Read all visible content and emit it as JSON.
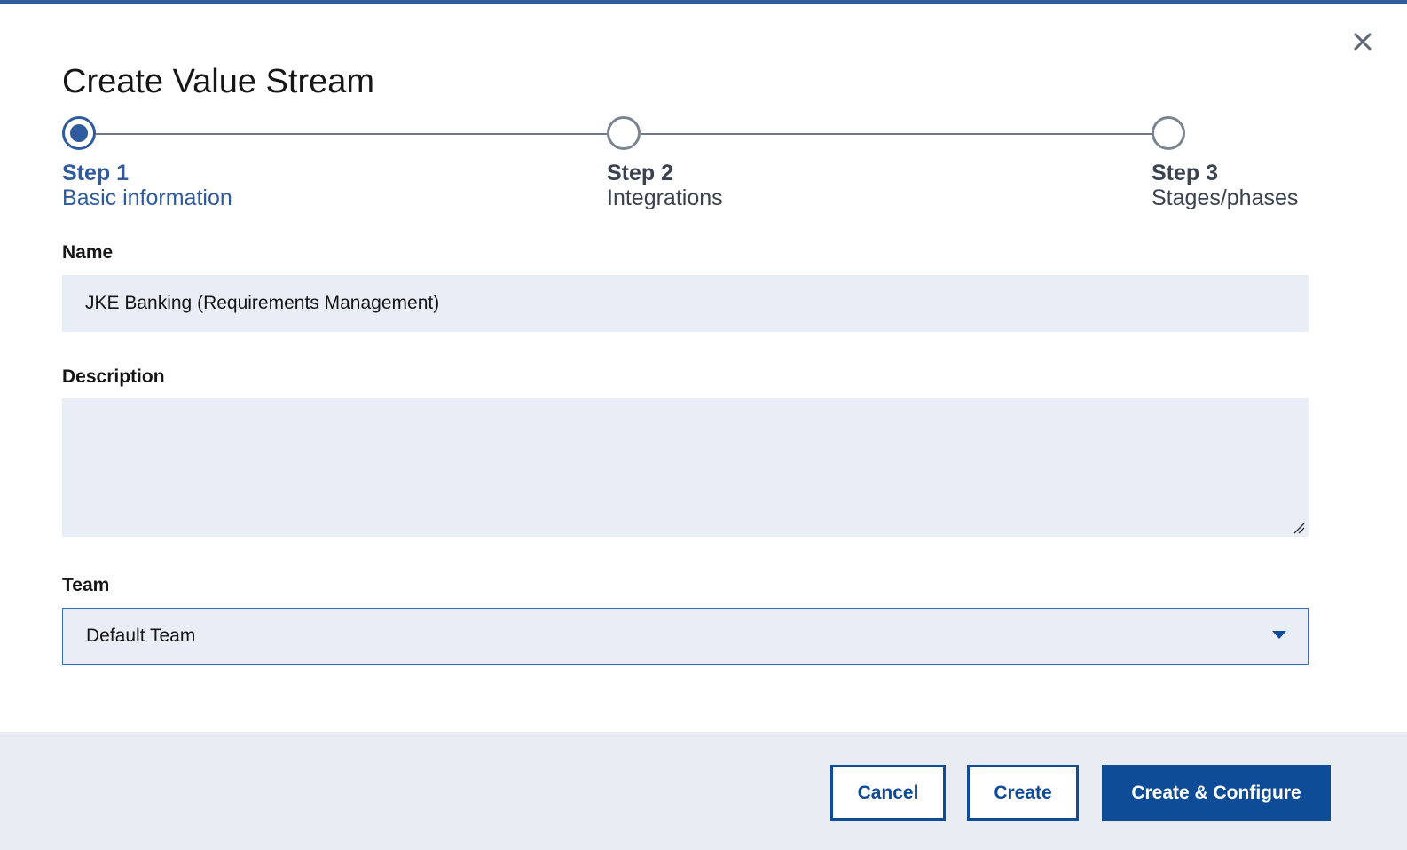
{
  "dialog": {
    "title": "Create Value Stream",
    "close_icon": "close-icon"
  },
  "stepper": {
    "steps": [
      {
        "number": "Step 1",
        "label": "Basic information",
        "state": "active"
      },
      {
        "number": "Step 2",
        "label": "Integrations",
        "state": "inactive"
      },
      {
        "number": "Step 3",
        "label": "Stages/phases",
        "state": "inactive"
      }
    ]
  },
  "form": {
    "name": {
      "label": "Name",
      "value": "JKE Banking (Requirements Management)"
    },
    "description": {
      "label": "Description",
      "value": ""
    },
    "team": {
      "label": "Team",
      "selected": "Default Team",
      "icon": "chevron-down-icon"
    }
  },
  "footer": {
    "cancel_label": "Cancel",
    "create_label": "Create",
    "create_configure_label": "Create & Configure"
  },
  "colors": {
    "accent": "#2f5a9e",
    "primary_button": "#0f4c97",
    "input_background": "#e8edf6",
    "footer_background": "#e9edf3"
  }
}
